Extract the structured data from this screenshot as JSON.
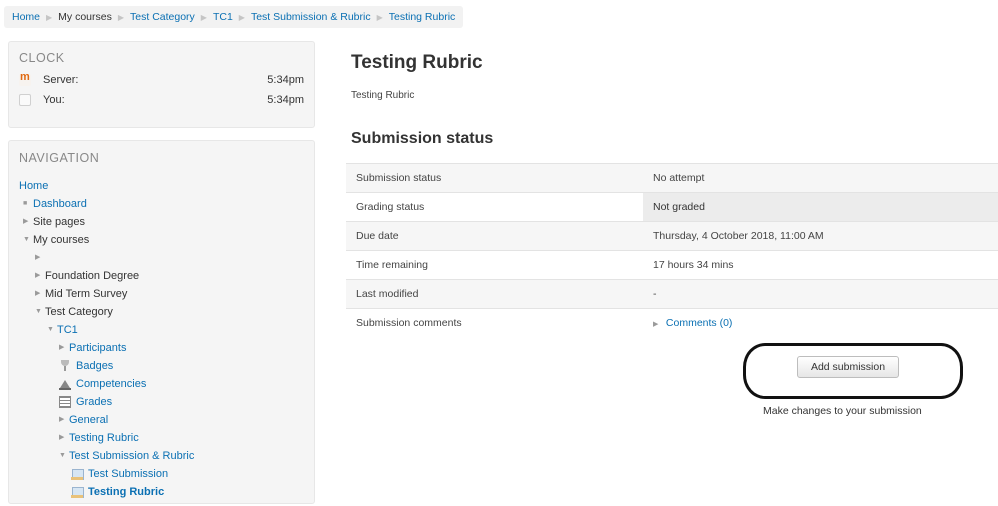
{
  "breadcrumb": [
    "Home",
    "My courses",
    "Test Category",
    "TC1",
    "Test Submission & Rubric",
    "Testing Rubric"
  ],
  "clock": {
    "title": "CLOCK",
    "rows": [
      {
        "label": "Server:",
        "time": "5:34pm"
      },
      {
        "label": "You:",
        "time": "5:34pm"
      }
    ]
  },
  "navigation": {
    "title": "NAVIGATION",
    "items": [
      {
        "label": "Home"
      },
      {
        "label": "Dashboard"
      },
      {
        "label": "Site pages"
      },
      {
        "label": "My courses"
      },
      {
        "label": ""
      },
      {
        "label": "Foundation Degree"
      },
      {
        "label": "Mid Term Survey"
      },
      {
        "label": "Test Category"
      },
      {
        "label": "TC1"
      },
      {
        "label": "Participants"
      },
      {
        "label": "Badges"
      },
      {
        "label": "Competencies"
      },
      {
        "label": "Grades"
      },
      {
        "label": "General"
      },
      {
        "label": "Testing Rubric"
      },
      {
        "label": "Test Submission & Rubric"
      },
      {
        "label": "Test Submission"
      },
      {
        "label": "Testing Rubric"
      }
    ]
  },
  "main": {
    "title": "Testing Rubric",
    "description": "Testing Rubric",
    "section_title": "Submission status",
    "rows": [
      {
        "key": "Submission status",
        "value": "No attempt"
      },
      {
        "key": "Grading status",
        "value": "Not graded"
      },
      {
        "key": "Due date",
        "value": "Thursday, 4 October 2018, 11:00 AM"
      },
      {
        "key": "Time remaining",
        "value": "17 hours 34 mins"
      },
      {
        "key": "Last modified",
        "value": "-"
      },
      {
        "key": "Submission comments",
        "value": "Comments (0)"
      }
    ],
    "add_button": "Add submission",
    "help_text": "Make changes to your submission"
  },
  "colors": {
    "link": "#0b70b3",
    "block_bg": "#f5f5f5",
    "annotation": "#111111"
  }
}
